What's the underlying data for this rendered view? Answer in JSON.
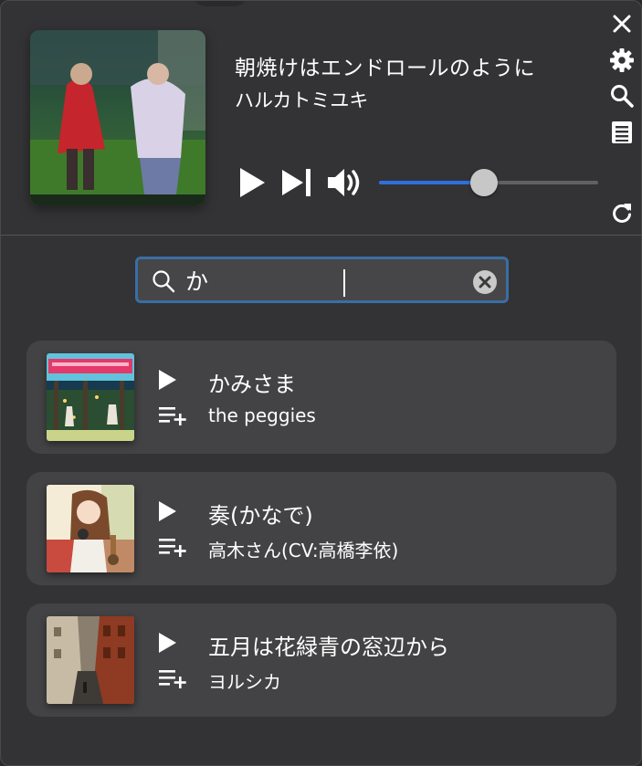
{
  "now_playing": {
    "title": "朝焼けはエンドロールのように",
    "artist": "ハルカトミユキ",
    "cover_icon": "album-art-harukatomiyuki",
    "volume_percent": 48
  },
  "side_icons": [
    "close-icon",
    "gear-icon",
    "search-icon",
    "list-icon",
    "refresh-icon"
  ],
  "search": {
    "value": "か",
    "placeholder": ""
  },
  "results": [
    {
      "title": "かみさま",
      "artist": "the peggies",
      "cover_icon": "album-art-hell-like-heaven"
    },
    {
      "title": "奏(かなで)",
      "artist": "高木さん(CV:高橋李依)",
      "cover_icon": "album-art-takagi-san"
    },
    {
      "title": "五月は花緑青の窓辺から",
      "artist": "ヨルシカ",
      "cover_icon": "album-art-yorushika"
    }
  ],
  "colors": {
    "background": "#333335",
    "accent": "#2f6fe0",
    "card": "#434345",
    "search_border": "#3a6ea5"
  }
}
